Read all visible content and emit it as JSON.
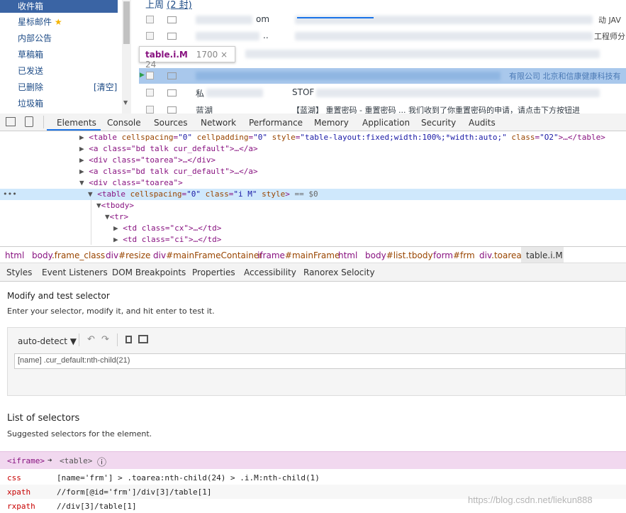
{
  "page": {
    "sidebar": {
      "active": "收件箱",
      "items": [
        "星标邮件",
        "内部公告",
        "草稿箱",
        "已发送",
        "已删除",
        "垃圾箱"
      ],
      "clear_label": "[清空]",
      "star": "★"
    },
    "header_week": "上周",
    "header_count": "(2 封)",
    "mail_rows": [
      {
        "text1": "om",
        "text2": "动 JAV"
      },
      {
        "text1": "..",
        "text2": "工程师分"
      },
      {
        "text1": "",
        "text2": ""
      },
      {
        "text1": "",
        "text2": "有限公司 北京和信康健康科技有"
      },
      {
        "text1": "私",
        "text2": "STOF"
      },
      {
        "text1": "蓝湖",
        "text2": "【蓝湖】 重置密码 - 重置密码 ... 我们收到了你重置密码的申请，请点击下方按钮进"
      }
    ],
    "tooltip_selector": "table.i.M",
    "tooltip_size": "1700 × 24"
  },
  "devtools": {
    "tabs": [
      "Elements",
      "Console",
      "Sources",
      "Network",
      "Performance",
      "Memory",
      "Application",
      "Security",
      "Audits"
    ],
    "tree": [
      {
        "indent": 0,
        "arrow": "▶",
        "html": "table_o2"
      },
      {
        "indent": 0,
        "arrow": "▶",
        "html": "a_bd"
      },
      {
        "indent": 0,
        "arrow": "▶",
        "html": "div_toarea"
      },
      {
        "indent": 0,
        "arrow": "▶",
        "html": "a_bd"
      },
      {
        "indent": 0,
        "arrow": "▼",
        "html": "div_toarea_open"
      }
    ],
    "tree_lines": {
      "l1_tag": "<table",
      "l1_a1": "cellspacing",
      "l1_v1": "\"0\"",
      "l1_a2": "cellpadding",
      "l1_v2": "\"0\"",
      "l1_a3": "style",
      "l1_v3": "\"table-layout:fixed;width:100%;*width:auto;\"",
      "l1_a4": "class",
      "l1_v4": "\"O2\"",
      "l1_end": ">…</table>",
      "l2": "<a class=\"bd talk cur_default\">…</a>",
      "l3": "<div class=\"toarea\">…</div>",
      "l4": "<a class=\"bd talk cur_default\">…</a>",
      "l5": "<div class=\"toarea\">",
      "l6_tag": "<table",
      "l6_a1": "cellspacing",
      "l6_v1": "\"0\"",
      "l6_a2": "class",
      "l6_v2": "\"i M\"",
      "l6_a3": "style",
      "l6_end": ">",
      "l6_eq": "== $0",
      "l7": "<tbody>",
      "l8": "<tr>",
      "l9": "<td class=\"cx\">…</td>",
      "l10": "<td class=\"ci\">…</td>",
      "dots": "•••"
    },
    "breadcrumbs": [
      {
        "t": "html",
        "a": ""
      },
      {
        "t": "body",
        "a": ".frame_class"
      },
      {
        "t": "div",
        "a": "#resize"
      },
      {
        "t": "div",
        "a": "#mainFrameContainer"
      },
      {
        "t": "iframe",
        "a": "#mainFrame"
      },
      {
        "t": "html",
        "a": ""
      },
      {
        "t": "body",
        "a": "#list.tbody"
      },
      {
        "t": "form",
        "a": "#frm"
      },
      {
        "t": "div",
        "a": ".toarea"
      },
      {
        "t": "table.i.M",
        "a": ""
      }
    ],
    "subtabs": [
      "Styles",
      "Event Listeners",
      "DOM Breakpoints",
      "Properties",
      "Accessibility",
      "Ranorex Selocity"
    ]
  },
  "selocity": {
    "modify_title": "Modify and test selector",
    "modify_sub": "Enter your selector, modify it, and hit enter to test it.",
    "detect_label": "auto-detect ▼",
    "selector_value": "[name] .cur_default:nth-child(21)",
    "list_title": "List of selectors",
    "list_sub": "Suggested selectors for the element.",
    "context_iframe": "<iframe>",
    "context_arrow": "➔",
    "context_table": "<table>",
    "info_icon": "ⓘ",
    "selectors": [
      {
        "kind": "css",
        "value": "[name='frm'] > .toarea:nth-child(24) > .i.M:nth-child(1)"
      },
      {
        "kind": "xpath",
        "value": "//form[@id='frm']/div[3]/table[1]"
      },
      {
        "kind": "rxpath",
        "value": "//div[3]/table[1]"
      }
    ]
  },
  "watermark": "https://blog.csdn.net/liekun888"
}
